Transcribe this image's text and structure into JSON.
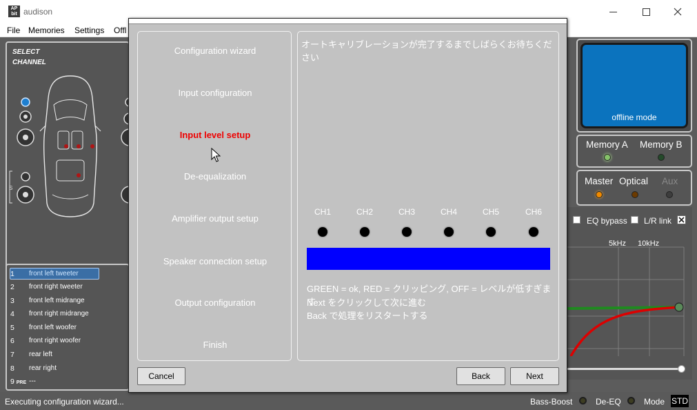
{
  "window": {
    "logo": "AP bit",
    "title": "audison",
    "minimize_icon": "minimize-icon",
    "maximize_icon": "maximize-icon",
    "close_icon": "close-icon"
  },
  "menu": [
    "File",
    "Memories",
    "Settings",
    "Offl"
  ],
  "left_panel": {
    "select_channel_line1": "SELECT",
    "select_channel_line2": "CHANNEL",
    "s_mark": "S"
  },
  "channels": [
    {
      "num": "1",
      "pre": "",
      "name": "front left tweeter",
      "selected": true
    },
    {
      "num": "2",
      "pre": "",
      "name": "front right tweeter",
      "selected": false
    },
    {
      "num": "3",
      "pre": "",
      "name": "front left midrange",
      "selected": false
    },
    {
      "num": "4",
      "pre": "",
      "name": "front right midrange",
      "selected": false
    },
    {
      "num": "5",
      "pre": "",
      "name": "front left woofer",
      "selected": false
    },
    {
      "num": "6",
      "pre": "",
      "name": "front right woofer",
      "selected": false
    },
    {
      "num": "7",
      "pre": "",
      "name": "rear left",
      "selected": false
    },
    {
      "num": "8",
      "pre": "",
      "name": "rear right",
      "selected": false
    },
    {
      "num": "9",
      "pre": "PRE",
      "name": "---",
      "selected": false
    }
  ],
  "right_panel": {
    "offline_mode": "offline mode",
    "memory_a": "Memory A",
    "memory_b": "Memory B",
    "master": "Master",
    "optical": "Optical",
    "aux": "Aux",
    "eq_bypass": "EQ bypass",
    "lr_link": "L/R link",
    "freq_5k": "5kHz",
    "freq_10k": "10kHz",
    "colors": {
      "memory_a_led": "#86c26a",
      "master_led": "#f08a00",
      "optical_led": "#6b3a00"
    }
  },
  "wizard": {
    "steps": [
      {
        "label": "Configuration wizard",
        "active": false
      },
      {
        "label": "Input configuration",
        "active": false
      },
      {
        "label": "Input level setup",
        "active": true
      },
      {
        "label": "De-equalization",
        "active": false
      },
      {
        "label": "Amplifier output setup",
        "active": false
      },
      {
        "label": "Speaker connection setup",
        "active": false
      },
      {
        "label": "Output configuration",
        "active": false
      },
      {
        "label": "Finish",
        "active": false
      }
    ],
    "heading": "オートキャリブレーションが完了するまでしばらくお待ちください",
    "channels": [
      "CH1",
      "CH2",
      "CH3",
      "CH4",
      "CH5",
      "CH6"
    ],
    "level_bar_color": "#0000ff",
    "info_lines": [
      "GREEN = ok, RED = クリッピング, OFF = レベルが低すぎます",
      "Next をクリックして次に進む",
      "Back で処理をリスタートする"
    ],
    "buttons": {
      "cancel": "Cancel",
      "back": "Back",
      "next": "Next"
    },
    "active_step_color": "#ee0000"
  },
  "status": {
    "text": "Executing configuration wizard...",
    "bass_boost": "Bass-Boost",
    "de_eq": "De-EQ",
    "mode": "Mode",
    "std": "STD"
  }
}
